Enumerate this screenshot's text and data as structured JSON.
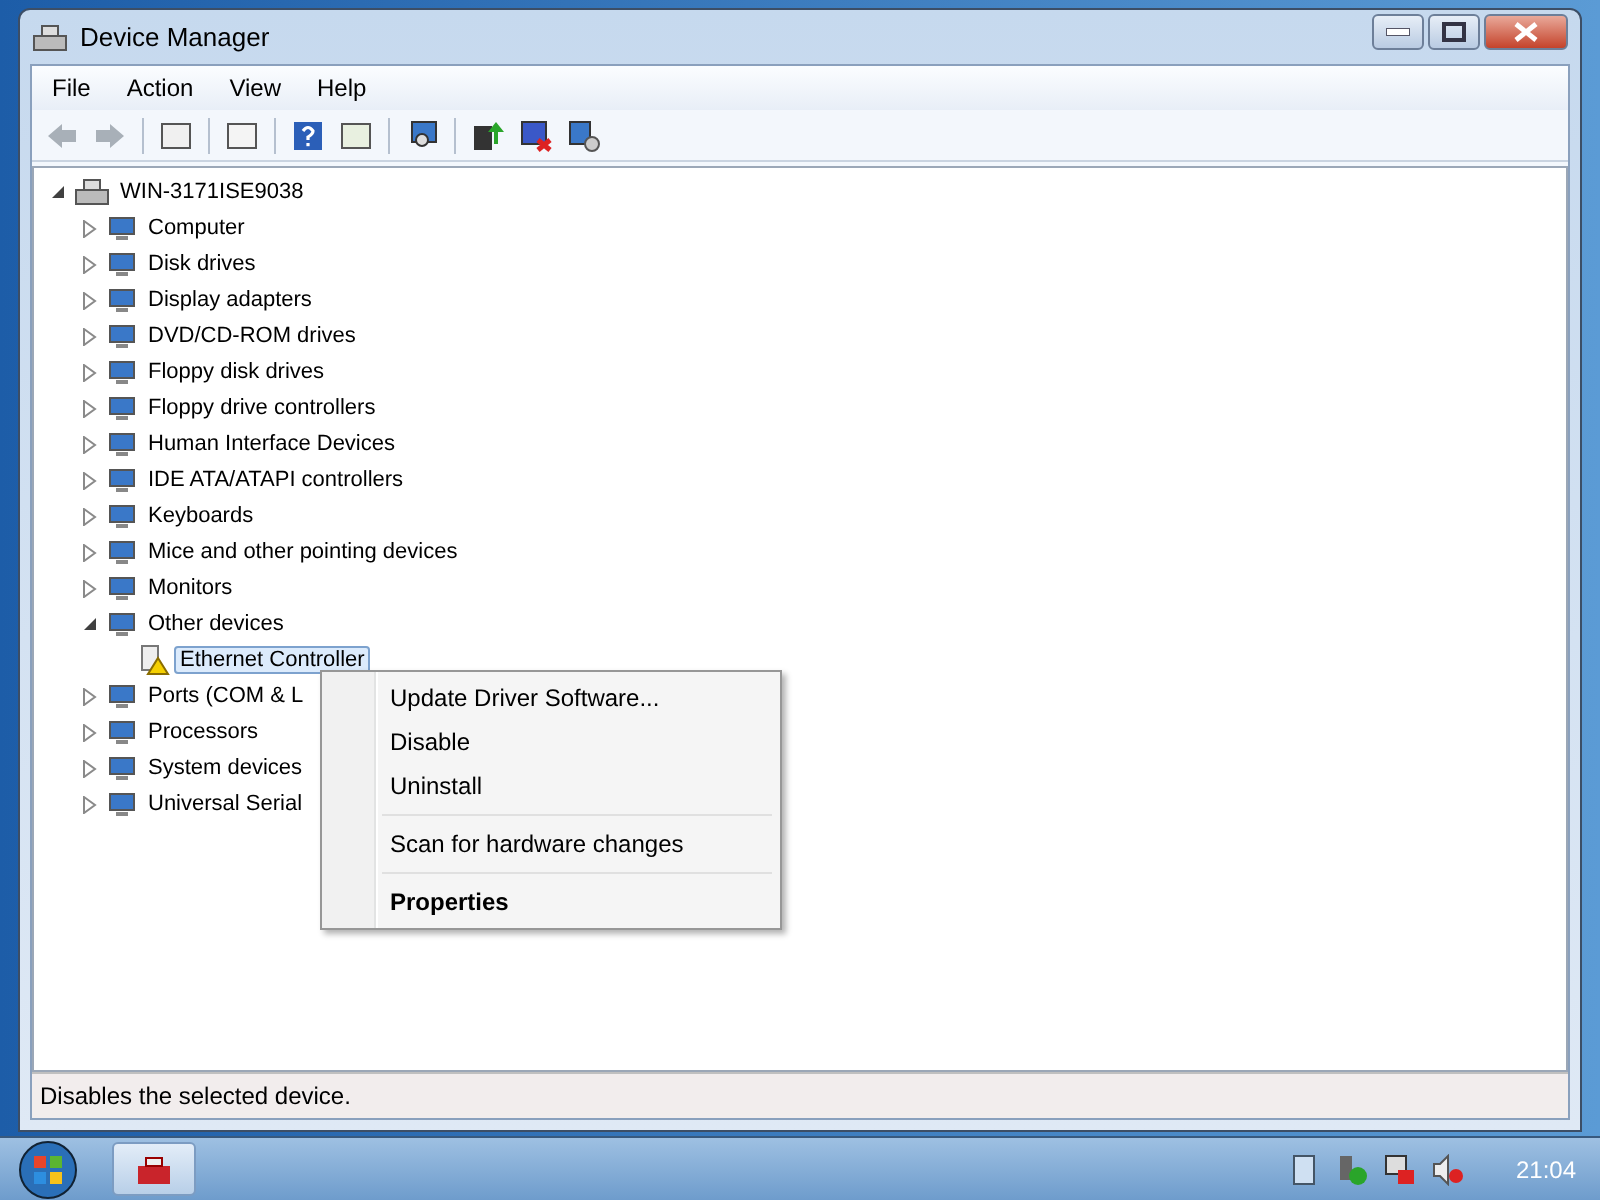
{
  "window": {
    "title": "Device Manager"
  },
  "menu_bar": [
    {
      "label": "File"
    },
    {
      "label": "Action"
    },
    {
      "label": "View"
    },
    {
      "label": "Help"
    }
  ],
  "tree": {
    "label": "WIN-3171ISE9038",
    "expanded": true,
    "selected": false,
    "children": [
      {
        "label": "Computer",
        "expanded": false,
        "selected": false
      },
      {
        "label": "Disk drives",
        "expanded": false,
        "selected": false
      },
      {
        "label": "Display adapters",
        "expanded": false,
        "selected": false
      },
      {
        "label": "DVD/CD-ROM drives",
        "expanded": false,
        "selected": false
      },
      {
        "label": "Floppy disk drives",
        "expanded": false,
        "selected": false
      },
      {
        "label": "Floppy drive controllers",
        "expanded": false,
        "selected": false
      },
      {
        "label": "Human Interface Devices",
        "expanded": false,
        "selected": false
      },
      {
        "label": "IDE ATA/ATAPI controllers",
        "expanded": false,
        "selected": false
      },
      {
        "label": "Keyboards",
        "expanded": false,
        "selected": false
      },
      {
        "label": "Mice and other pointing devices",
        "expanded": false,
        "selected": false
      },
      {
        "label": "Monitors",
        "expanded": false,
        "selected": false
      },
      {
        "label": "Other devices",
        "expanded": true,
        "selected": false,
        "children": [
          {
            "label": "Ethernet Controller",
            "selected": true,
            "warning": true
          }
        ]
      },
      {
        "label": "Ports (COM & L",
        "expanded": false,
        "selected": false
      },
      {
        "label": "Processors",
        "expanded": false,
        "selected": false
      },
      {
        "label": "System devices",
        "expanded": false,
        "selected": false
      },
      {
        "label": "Universal Serial",
        "expanded": false,
        "selected": false
      }
    ]
  },
  "context_menu": [
    {
      "kind": "item",
      "label": "Update Driver Software...",
      "bold": false
    },
    {
      "kind": "item",
      "label": "Disable",
      "bold": false
    },
    {
      "kind": "item",
      "label": "Uninstall",
      "bold": false
    },
    {
      "kind": "separator"
    },
    {
      "kind": "item",
      "label": "Scan for hardware changes",
      "bold": false
    },
    {
      "kind": "separator"
    },
    {
      "kind": "item",
      "label": "Properties",
      "bold": true
    }
  ],
  "status_bar": {
    "text": "Disables the selected device."
  },
  "taskbar": {
    "clock": "21:04"
  }
}
